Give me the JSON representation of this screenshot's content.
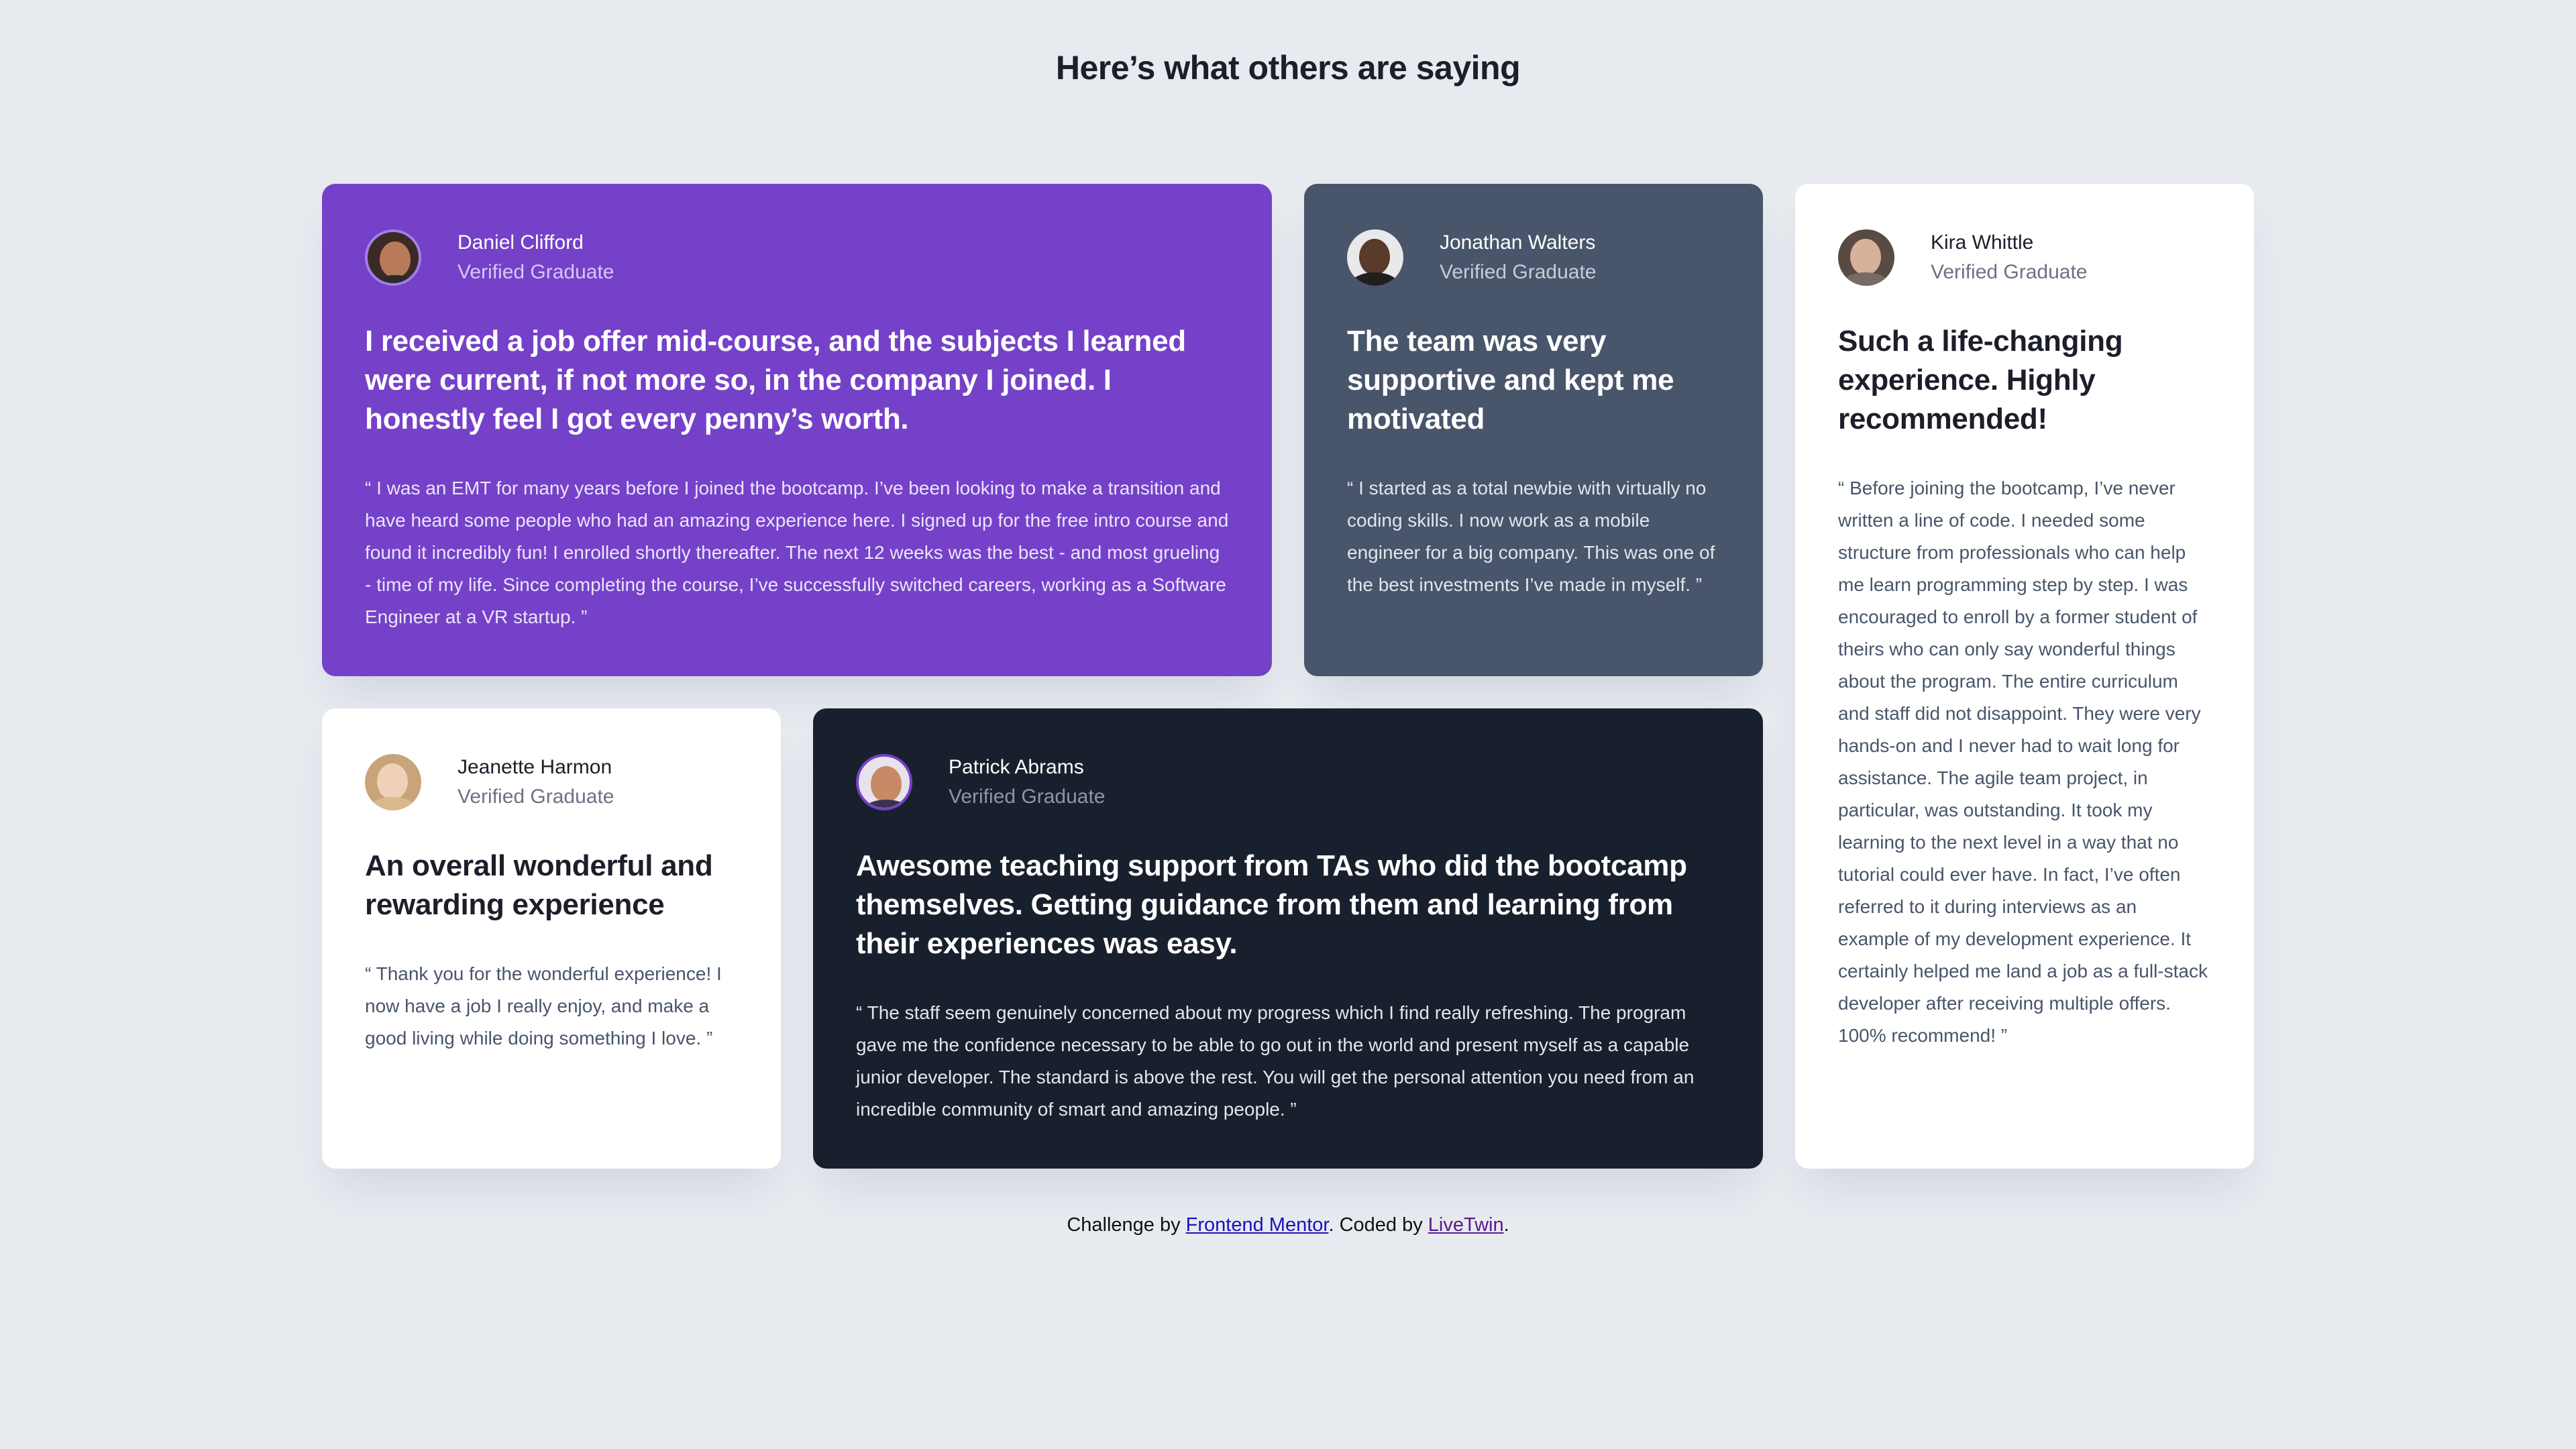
{
  "page": {
    "title": "Here’s what others are saying"
  },
  "testimonials": [
    {
      "name": "Daniel Clifford",
      "role": "Verified Graduate",
      "headline": "I received a job offer mid-course, and the subjects I learned were current, if not more so, in the company I joined. I honestly feel I got every penny’s worth.",
      "quote": "“ I was an EMT for many years before I joined the bootcamp. I’ve been looking to make a transition and have heard some people who had an amazing experience here. I signed up for the free intro course and found it incredibly fun! I enrolled shortly thereafter. The next 12 weeks was the best - and most grueling - time of my life. Since completing the course, I’ve successfully switched careers, working as a Software Engineer at a VR startup. ”",
      "background": "#7541c8",
      "avatar_ring": "#a37ee6"
    },
    {
      "name": "Jonathan Walters",
      "role": "Verified Graduate",
      "headline": "The team was very supportive and kept me motivated",
      "quote": "“ I started as a total newbie with virtually no coding skills. I now work as a mobile engineer for a big company. This was one of the best investments I’ve made in myself. ”",
      "background": "#48556a"
    },
    {
      "name": "Kira Whittle",
      "role": "Verified Graduate",
      "headline": "Such a life-changing experience. Highly recommended!",
      "quote": "“ Before joining the bootcamp, I’ve never written a line of code. I needed some structure from professionals who can help me learn programming step by step. I was encouraged to enroll by a former student of theirs who can only say wonderful things about the program. The entire curriculum and staff did not disappoint. They were very hands-on and I never had to wait long for assistance. The agile team project, in particular, was outstanding. It took my learning to the next level in a way that no tutorial could ever have. In fact, I’ve often referred to it during interviews as an example of my development experience. It certainly helped me land a job as a full-stack developer after receiving multiple offers. 100% recommend! ”",
      "background": "#ffffff"
    },
    {
      "name": "Jeanette Harmon",
      "role": "Verified Graduate",
      "headline": "An overall wonderful and rewarding experience",
      "quote": "“ Thank you for the wonderful experience! I now have a job I really enjoy, and make a good living while doing something I love. ”",
      "background": "#ffffff"
    },
    {
      "name": "Patrick Abrams",
      "role": "Verified Graduate",
      "headline": "Awesome teaching support from TAs who did the bootcamp themselves. Getting guidance from them and learning from their experiences was easy.",
      "quote": "“ The staff seem genuinely concerned about my progress which I find really refreshing. The program gave me the confidence necessary to be able to go out in the world and present myself as a capable junior developer. The standard is above the rest. You will get the personal attention you need from an incredible community of smart and amazing people. ”",
      "background": "#19202d",
      "avatar_ring": "#7541c8"
    }
  ],
  "footer": {
    "prefix": "Challenge by ",
    "link1": "Frontend Mentor",
    "middle": ". Coded by ",
    "link2": "LiveTwin",
    "suffix": "."
  }
}
